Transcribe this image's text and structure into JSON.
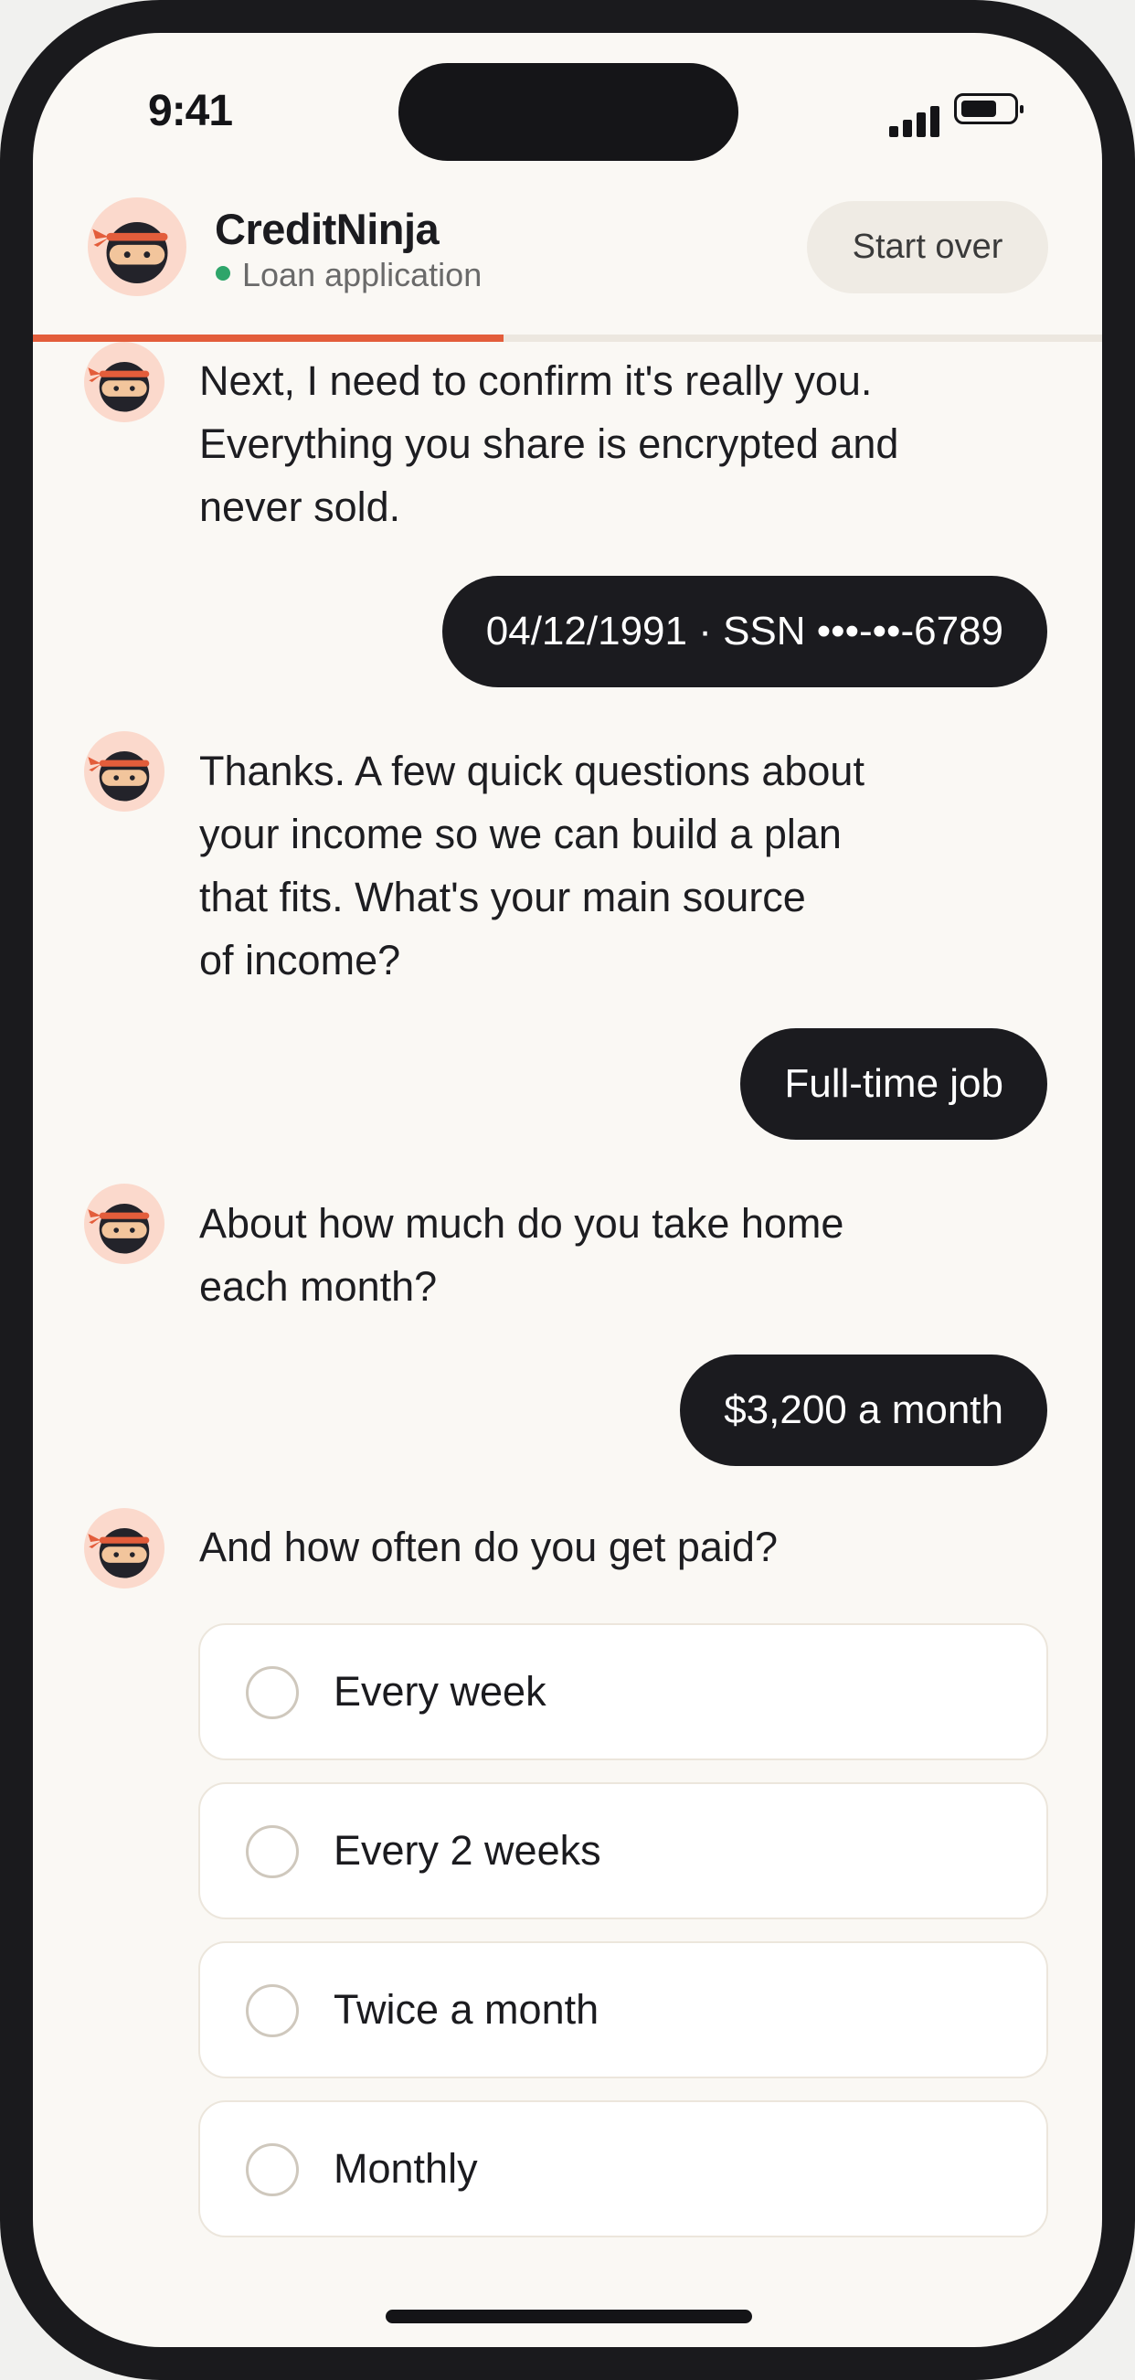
{
  "status_bar": {
    "time": "9:41"
  },
  "header": {
    "brand": "CreditNinja",
    "subtitle": "Loan application",
    "start_over_label": "Start over",
    "progress": 0.44
  },
  "messages": [
    {
      "from": "bot",
      "lines": [
        "Next, I need to confirm it's really you.",
        "Everything you share is encrypted and",
        "never sold."
      ]
    },
    {
      "from": "user",
      "text": "04/12/1991 · SSN •••-••-6789"
    },
    {
      "from": "bot",
      "lines": [
        "Thanks. A few quick questions about",
        "your income so we can build a plan",
        "that fits. What's your main source",
        "of income?"
      ]
    },
    {
      "from": "user",
      "text": "Full-time job"
    },
    {
      "from": "bot",
      "lines": [
        "About how much do you take home",
        "each month?"
      ]
    },
    {
      "from": "user",
      "text": "$3,200 a month"
    },
    {
      "from": "bot",
      "lines": [
        "And how often do you get paid?"
      ]
    }
  ],
  "pay_frequency_options": [
    "Every week",
    "Every 2 weeks",
    "Twice a month",
    "Monthly"
  ],
  "colors": {
    "accent": "#e35d3b",
    "online": "#2ea56a",
    "bubble": "#1b1b1f",
    "background": "#faf8f4"
  },
  "icons": {
    "avatar": "ninja-avatar-icon",
    "signal": "signal-icon",
    "battery": "battery-icon"
  }
}
